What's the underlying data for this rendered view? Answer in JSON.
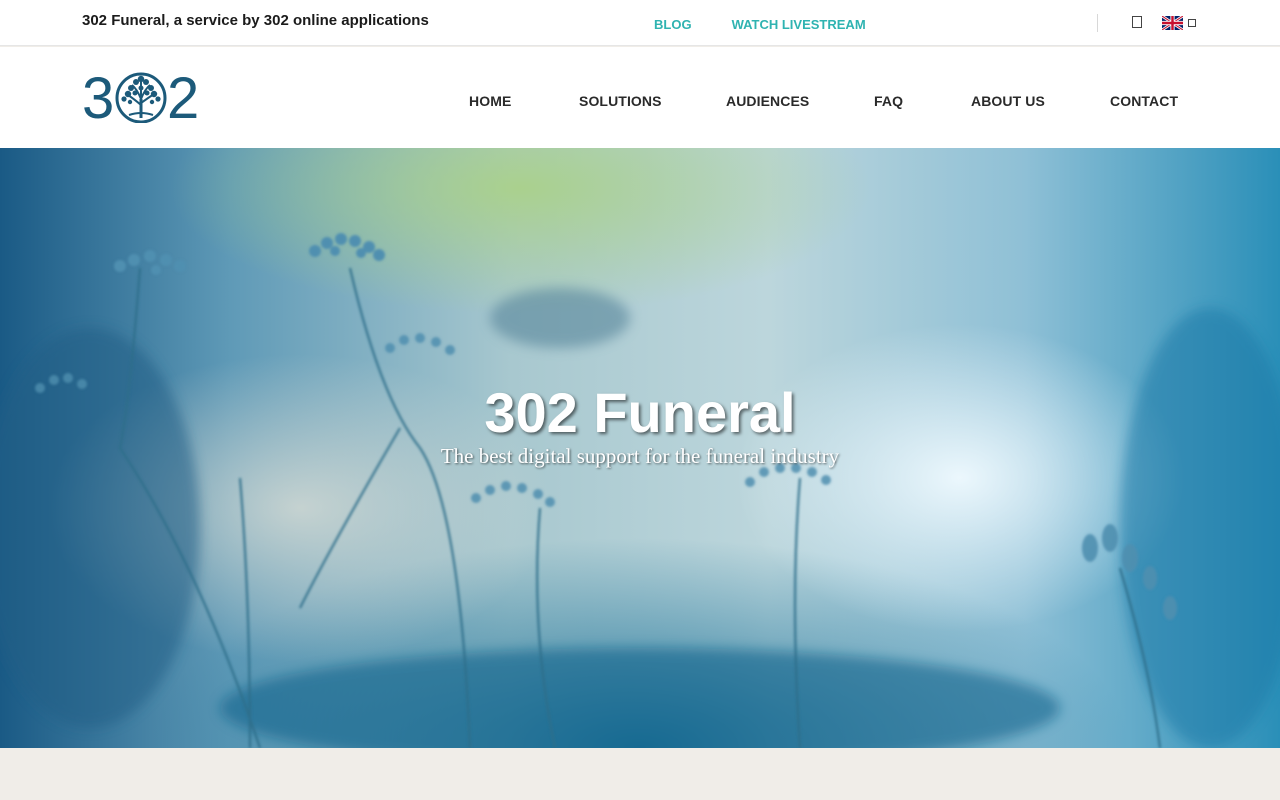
{
  "topbar": {
    "tagline": "302 Funeral, a service by 302 online applications",
    "links": [
      {
        "label": "BLOG"
      },
      {
        "label": "WATCH LIVESTREAM"
      }
    ],
    "user_icon": "user-icon",
    "language_icon": "uk-flag-icon"
  },
  "header": {
    "logo_text": "302",
    "nav": [
      {
        "label": "HOME"
      },
      {
        "label": "SOLUTIONS"
      },
      {
        "label": "AUDIENCES"
      },
      {
        "label": "FAQ"
      },
      {
        "label": "ABOUT US"
      },
      {
        "label": "CONTACT"
      }
    ]
  },
  "hero": {
    "title": "302 Funeral",
    "subtitle": "The best digital support for the funeral industry"
  },
  "colors": {
    "accent": "#2fb3b1",
    "logo": "#1c5a7a",
    "footer_band": "#f0ede8"
  }
}
